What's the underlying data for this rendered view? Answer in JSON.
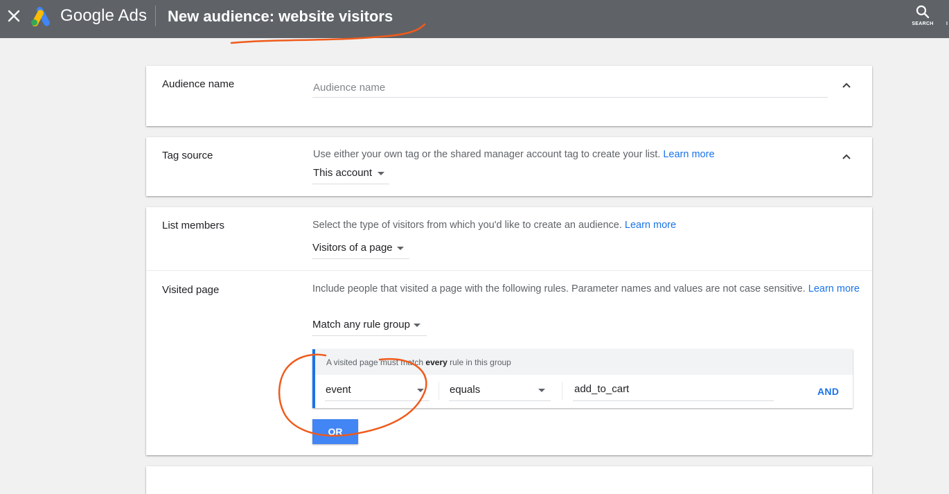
{
  "topbar": {
    "brand": "Google Ads",
    "page_title": "New audience: website visitors",
    "search_label": "SEARCH",
    "next_item_label_cut": "I"
  },
  "audience_name": {
    "label": "Audience name",
    "placeholder": "Audience name",
    "value": ""
  },
  "tag_source": {
    "label": "Tag source",
    "description": "Use either your own tag or the shared manager account tag to create your list.",
    "learn_more": "Learn more",
    "selected": "This account"
  },
  "list_members": {
    "label": "List members",
    "description": "Select the type of visitors from which you'd like to create an audience.",
    "learn_more": "Learn more",
    "selected": "Visitors of a page"
  },
  "visited_page": {
    "label": "Visited page",
    "description": "Include people that visited a page with the following rules. Parameter names and values are not case sensitive.",
    "learn_more_1": "Learn",
    "learn_more_2": "more",
    "match_selected": "Match any rule group",
    "rule_group": {
      "header_pre": "A visited page must match",
      "header_bold": "every",
      "header_post": "rule in this group",
      "rule": {
        "parameter": "event",
        "operator": "equals",
        "value": "add_to_cart"
      },
      "and_label": "AND"
    },
    "or_label": "OR"
  },
  "colors": {
    "topbar": "#5f6368",
    "accent_blue": "#1a73e8",
    "button_blue": "#4285f4",
    "annotation_orange": "#f05a1a"
  },
  "icons": [
    "close-icon",
    "google-ads-logo",
    "search-icon",
    "chevron-up-icon",
    "dropdown-arrow-icon"
  ]
}
